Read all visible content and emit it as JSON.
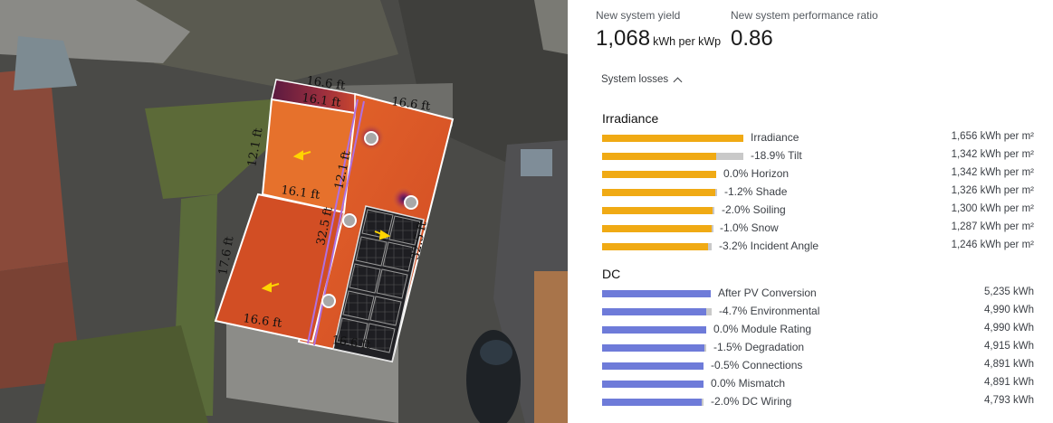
{
  "kpis": {
    "yield": {
      "label": "New system yield",
      "value": "1,068",
      "unit": "kWh per kWp"
    },
    "performance_ratio": {
      "label": "New system performance ratio",
      "value": "0.86"
    }
  },
  "losses_toggle": {
    "label": "System losses",
    "icon": "chevron-up-icon"
  },
  "colors": {
    "irradiance_bar": "#f0aa14",
    "dc_bar": "#6e7bd9",
    "loss_segment": "#c9c9c9"
  },
  "irradiance": {
    "title": "Irradiance",
    "rows": [
      {
        "label": "Irradiance",
        "value": "1,656 kWh per m²",
        "fraction": 1.0,
        "loss": 0.0
      },
      {
        "label": "-18.9% Tilt",
        "value": "1,342 kWh per m²",
        "fraction": 0.81,
        "loss": 0.19
      },
      {
        "label": "0.0% Horizon",
        "value": "1,342 kWh per m²",
        "fraction": 0.81,
        "loss": 0.0
      },
      {
        "label": "-1.2% Shade",
        "value": "1,326 kWh per m²",
        "fraction": 0.8,
        "loss": 0.01
      },
      {
        "label": "-2.0% Soiling",
        "value": "1,300 kWh per m²",
        "fraction": 0.785,
        "loss": 0.016
      },
      {
        "label": "-1.0% Snow",
        "value": "1,287 kWh per m²",
        "fraction": 0.777,
        "loss": 0.008
      },
      {
        "label": "-3.2% Incident Angle",
        "value": "1,246 kWh per m²",
        "fraction": 0.752,
        "loss": 0.025
      }
    ]
  },
  "dc": {
    "title": "DC",
    "rows": [
      {
        "label": "After PV Conversion",
        "value": "5,235 kWh",
        "fraction": 0.752,
        "loss": 0.0
      },
      {
        "label": "-4.7% Environmental",
        "value": "4,990 kWh",
        "fraction": 0.717,
        "loss": 0.035
      },
      {
        "label": "0.0% Module Rating",
        "value": "4,990 kWh",
        "fraction": 0.717,
        "loss": 0.0
      },
      {
        "label": "-1.5% Degradation",
        "value": "4,915 kWh",
        "fraction": 0.706,
        "loss": 0.011
      },
      {
        "label": "-0.5% Connections",
        "value": "4,891 kWh",
        "fraction": 0.703,
        "loss": 0.003
      },
      {
        "label": "0.0% Mismatch",
        "value": "4,891 kWh",
        "fraction": 0.703,
        "loss": 0.0
      },
      {
        "label": "-2.0% DC Wiring",
        "value": "4,793 kWh",
        "fraction": 0.689,
        "loss": 0.014
      }
    ]
  },
  "map": {
    "dimension_labels": [
      "16.6 ft",
      "16.1 ft",
      "16.6 ft",
      "12.1 ft",
      "16.1 ft",
      "32.5 ft",
      "12.1 ft",
      "17.6 ft",
      "16.6 ft",
      "16.6 ft",
      "32.5 ft"
    ]
  }
}
